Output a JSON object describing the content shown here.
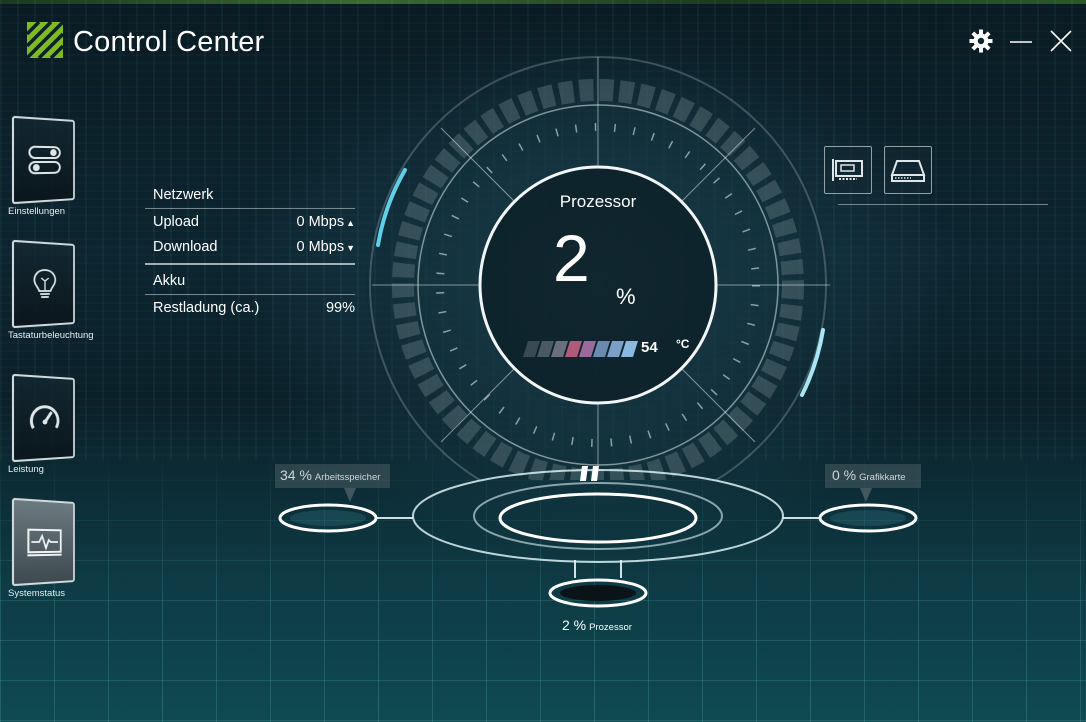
{
  "app": {
    "title": "Control Center"
  },
  "colors": {
    "accent": "#7dbb1e",
    "glow": "#5fd0e8",
    "background": "#0b1f28"
  },
  "window_controls": [
    {
      "name": "settings",
      "icon": "gear-icon"
    },
    {
      "name": "minimize",
      "icon": "minimize-icon"
    },
    {
      "name": "close",
      "icon": "close-icon"
    }
  ],
  "sidebar": {
    "items": [
      {
        "label": "Einstellungen",
        "icon": "toggle-switch-icon"
      },
      {
        "label": "Tastaturbeleuchtung",
        "icon": "lightbulb-icon"
      },
      {
        "label": "Leistung",
        "icon": "speedometer-icon"
      },
      {
        "label": "Systemstatus",
        "icon": "monitor-pulse-icon",
        "active": true
      }
    ]
  },
  "network": {
    "heading": "Netzwerk",
    "upload_label": "Upload",
    "upload_value": "0 Mbps",
    "download_label": "Download",
    "download_value": "0 Mbps"
  },
  "battery": {
    "heading": "Akku",
    "remaining_label": "Restladung (ca.)",
    "remaining_value": "99%"
  },
  "hardware_buttons": [
    {
      "icon": "graphics-card-icon"
    },
    {
      "icon": "drive-icon"
    }
  ],
  "gauge": {
    "title": "Prozessor",
    "value": "2",
    "unit": "%",
    "temperature": "54",
    "temperature_unit": "°C"
  },
  "nodes": {
    "memory": {
      "percent": "34 %",
      "label": "Arbeitsspeicher"
    },
    "gpu": {
      "percent": "0 %",
      "label": "Grafikkarte"
    },
    "cpu": {
      "percent": "2 %",
      "label": "Prozessor"
    }
  }
}
